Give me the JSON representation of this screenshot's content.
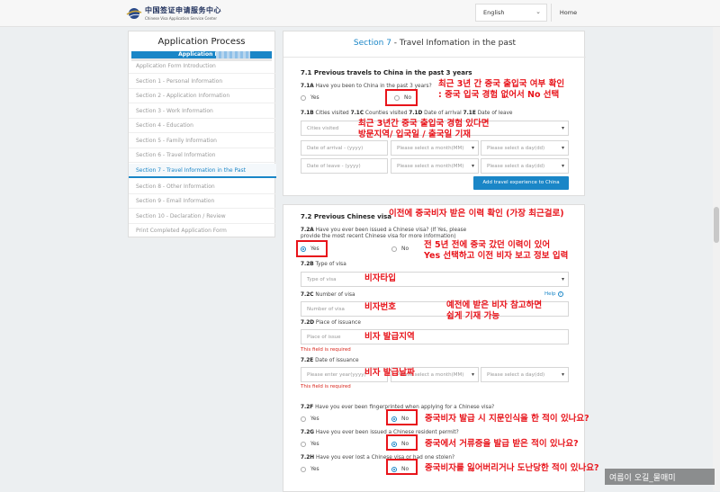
{
  "header": {
    "logo_cn": "中国签证申请服务中心",
    "logo_en": "Chinese Visa Application Service Center",
    "language": "English",
    "home": "Home"
  },
  "sidebar": {
    "title": "Application Process",
    "application_no": "Application No.",
    "items": [
      "Application Form Introduction",
      "Section 1 - Personal Information",
      "Section 2 - Application Information",
      "Section 3 - Work Information",
      "Section 4 - Education",
      "Section 5 - Family Information",
      "Section 6 - Travel Information",
      "Section 7 - Travel Information in the Past",
      "Section 8 - Other Information",
      "Section 9 - Email Information",
      "Section 10 - Declaration / Review",
      "Print Completed Application Form"
    ],
    "active_index": 7
  },
  "section": {
    "number": "Section 7",
    "title": " - Travel Infomation in the past"
  },
  "s71": {
    "heading": "7.1 Previous travels to China in the past 3 years",
    "q1a_num": "7.1A",
    "q1a": " Have you been to China in the past 3 years?",
    "yes": "Yes",
    "no": "No",
    "q1b_1b": "7.1B",
    "q1b_t1": " Cities visited ",
    "q1b_1c": "7.1C",
    "q1b_t2": " Counties visited ",
    "q1b_1d": "7.1D",
    "q1b_t3": " Date of arrival ",
    "q1b_1e": "7.1E",
    "q1b_t4": " Date of leave",
    "cities_ph": "Cities visited",
    "arrival_ph": "Date of arrival - (yyyy)",
    "leave_ph": "Date of leave - (yyyy)",
    "month_ph": "Please select a month(MM)",
    "day_ph": "Please select a day(dd)",
    "add_btn": "Add travel experience to China"
  },
  "s72": {
    "heading": "7.2 Previous Chinese visa",
    "q2a_num": "7.2A",
    "q2a": " Have you ever been issued a Chinese visa? (If Yes, please provide the most recent Chinese visa for more information)",
    "yes": "Yes",
    "no": "No",
    "q2b_num": "7.2B",
    "q2b": " Type of visa",
    "type_ph": "Type of visa",
    "q2c_num": "7.2C",
    "q2c": " Number of visa",
    "help": "Help",
    "number_ph": "Number of visa",
    "q2d_num": "7.2D",
    "q2d": " Place of issuance",
    "place_ph": "Place of issue",
    "required1": "This field is required",
    "q2e_num": "7.2E",
    "q2e": " Date of issuance",
    "year_ph": "Please enter year(yyyy)",
    "month_ph": "Please select a month(MM)",
    "day_ph": "Please select a day(dd)",
    "required2": "This field is required",
    "q2f_num": "7.2F",
    "q2f": " Have you ever been fingerprinted when applying for a Chinese visa?",
    "q2g_num": "7.2G",
    "q2g": " Have you ever been issued a Chinese resident permit?",
    "q2h_num": "7.2H",
    "q2h": " Have you ever lost a Chinese visa or had one stolen?"
  },
  "annotations": {
    "a1": "최근 3년 간 중국 출입국 여부 확인",
    "a1b": ": 중국 입국 경험 없어서 No 선택",
    "a2": "최근 3년간 중국 출입국 경험 있다면",
    "a2b": "방문지역/ 입국일 / 출국일 기재",
    "a3": "이전에 중국비자 받은 이력 확인 (가장 최근걸로)",
    "a4": "전 5년 전에 중국 갔던 이력이 있어",
    "a4b": "Yes 선택하고 이전 비자 보고 정보 입력",
    "a5": "비자타입",
    "a6": "비자번호",
    "a7": "예전에 받은 비자 참고하면",
    "a7b": "쉽게 기재 가능",
    "a8": "비자 발급지역",
    "a9": "비자 발급날짜",
    "a10": "중국비자 발급 시 지문인식을 한 적이 있나요?",
    "a11": "중국에서 거류증을 발급 받은 적이 있나요?",
    "a12": "중국비자를 잃어버리거나 도난당한 적이 있나요?"
  },
  "watermark": "여름이 오길_물매미",
  "colors": {
    "accent": "#1a86c7",
    "annotation": "#e8141b",
    "required": "#d9261c"
  }
}
